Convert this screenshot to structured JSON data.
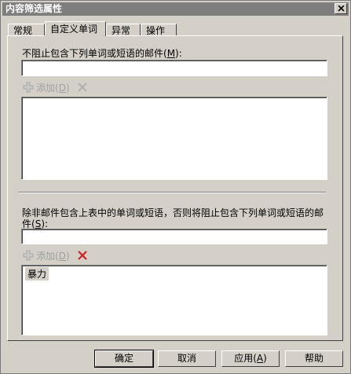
{
  "window": {
    "title": "内容筛选属性"
  },
  "tabs": [
    {
      "label": "常规"
    },
    {
      "label": "自定义单词"
    },
    {
      "label": "异常"
    },
    {
      "label": "操作"
    }
  ],
  "allow_section": {
    "label_prefix": "不阻止包含下列单词或短语的邮件(",
    "label_key": "M",
    "label_suffix": "):",
    "input_value": "",
    "add_label_prefix": "添加(",
    "add_label_key": "D",
    "add_label_suffix": ")",
    "list_items": []
  },
  "block_section": {
    "label_line1": "除非邮件包含上表中的单词或短语，否则将阻止包含下列单词或短语的邮",
    "label_line2_prefix": "件(",
    "label_key": "S",
    "label_suffix": "):",
    "input_value": "",
    "add_label_prefix": "添加(",
    "add_label_key": "D",
    "add_label_suffix": ")",
    "list_items": [
      "暴力"
    ]
  },
  "buttons": {
    "ok": "确定",
    "cancel": "取消",
    "apply_prefix": "应用(",
    "apply_key": "A",
    "apply_suffix": ")",
    "help": "帮助"
  },
  "colors": {
    "dialog_bg": "#d4d0c8",
    "title_bar": "#7e7e7e",
    "delete_active_red": "#d42020",
    "disabled_text": "#a0a0a0"
  }
}
